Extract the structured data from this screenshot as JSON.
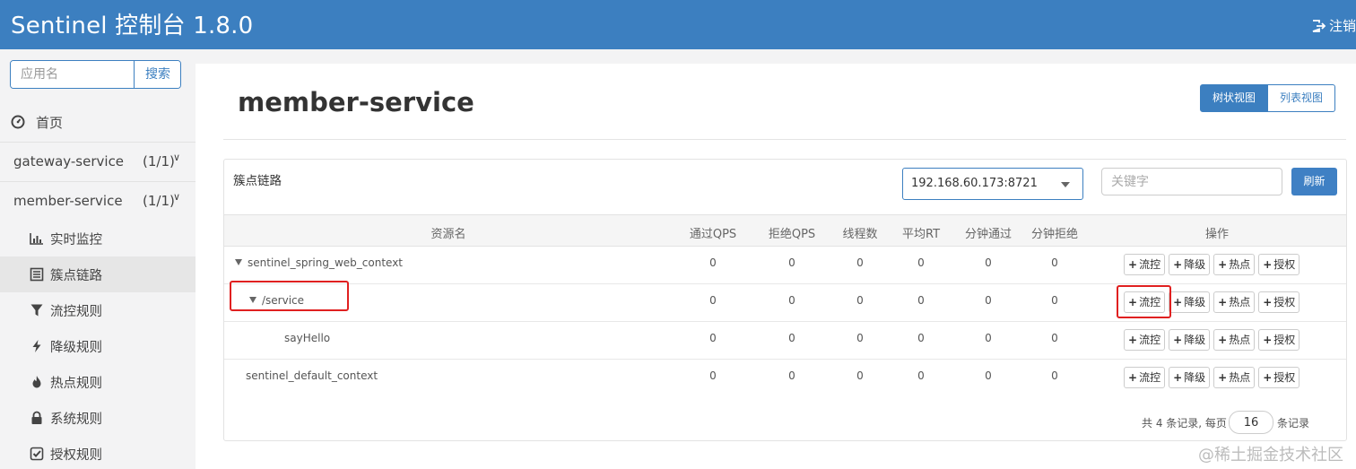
{
  "header": {
    "title": "Sentinel 控制台 1.8.0",
    "logout_label": "注销"
  },
  "sidebar": {
    "search_placeholder": "应用名",
    "search_button": "搜索",
    "home_label": "首页",
    "apps": [
      {
        "name": "gateway-service",
        "count": "(1/1)"
      },
      {
        "name": "member-service",
        "count": "(1/1)"
      }
    ],
    "sub_items": [
      {
        "label": "实时监控",
        "icon": "bar-chart-icon"
      },
      {
        "label": "簇点链路",
        "icon": "list-icon",
        "active": true
      },
      {
        "label": "流控规则",
        "icon": "filter-icon"
      },
      {
        "label": "降级规则",
        "icon": "bolt-icon"
      },
      {
        "label": "热点规则",
        "icon": "fire-icon"
      },
      {
        "label": "系统规则",
        "icon": "lock-icon"
      },
      {
        "label": "授权规则",
        "icon": "check-square-icon"
      }
    ]
  },
  "main": {
    "page_title": "member-service",
    "view_tree": "树状视图",
    "view_list": "列表视图",
    "panel_title": "簇点链路",
    "machine_select": "192.168.60.173:8721",
    "keyword_placeholder": "关键字",
    "refresh_button": "刷新",
    "columns": [
      "资源名",
      "通过QPS",
      "拒绝QPS",
      "线程数",
      "平均RT",
      "分钟通过",
      "分钟拒绝",
      "操作"
    ],
    "rows": [
      {
        "resource": "sentinel_spring_web_context",
        "expandable": true,
        "level": 0,
        "values": [
          "0",
          "0",
          "0",
          "0",
          "0",
          "0"
        ]
      },
      {
        "resource": "/service",
        "expandable": true,
        "level": 1,
        "values": [
          "0",
          "0",
          "0",
          "0",
          "0",
          "0"
        ]
      },
      {
        "resource": "sayHello",
        "expandable": false,
        "level": 2,
        "values": [
          "0",
          "0",
          "0",
          "0",
          "0",
          "0"
        ]
      },
      {
        "resource": "sentinel_default_context",
        "expandable": false,
        "level": 0,
        "values": [
          "0",
          "0",
          "0",
          "0",
          "0",
          "0"
        ]
      }
    ],
    "actions": [
      "流控",
      "降级",
      "热点",
      "授权"
    ],
    "action_symbol": "+",
    "pager": {
      "summary": "共 4 条记录, 每页",
      "page_size": "16",
      "suffix": "条记录"
    }
  },
  "watermark": "@稀土掘金技术社区",
  "colors": {
    "header": "#3c7fc0",
    "primary": "#3c7fc0",
    "highlight": "#e02020"
  }
}
